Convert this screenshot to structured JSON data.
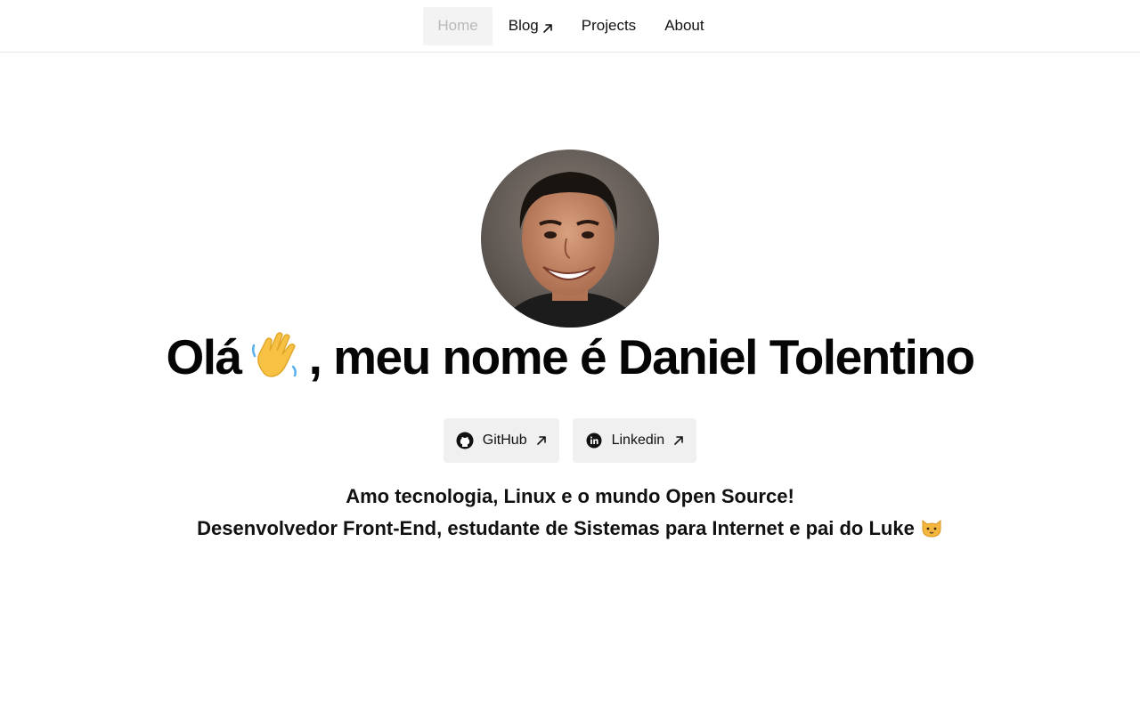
{
  "nav": {
    "items": [
      {
        "label": "Home",
        "active": true,
        "external": false
      },
      {
        "label": "Blog",
        "active": false,
        "external": true
      },
      {
        "label": "Projects",
        "active": false,
        "external": false
      },
      {
        "label": "About",
        "active": false,
        "external": false
      }
    ]
  },
  "hero": {
    "headline_pre": "Olá",
    "headline_post": ", meu nome é Daniel Tolentino",
    "wave_emoji_icon": "waving-hand-icon"
  },
  "links": {
    "github_label": "GitHub",
    "linkedin_label": "Linkedin"
  },
  "bio": {
    "line1": "Amo tecnologia, Linux e o mundo Open Source!",
    "line2": "Desenvolvedor Front-End, estudante de Sistemas para Internet e pai do Luke",
    "cat_icon": "cat-face-icon"
  },
  "colors": {
    "nav_active_bg": "#f3f3f3",
    "nav_active_text": "#b9b9b9",
    "button_bg": "#f0f0f0",
    "text": "#111111"
  }
}
